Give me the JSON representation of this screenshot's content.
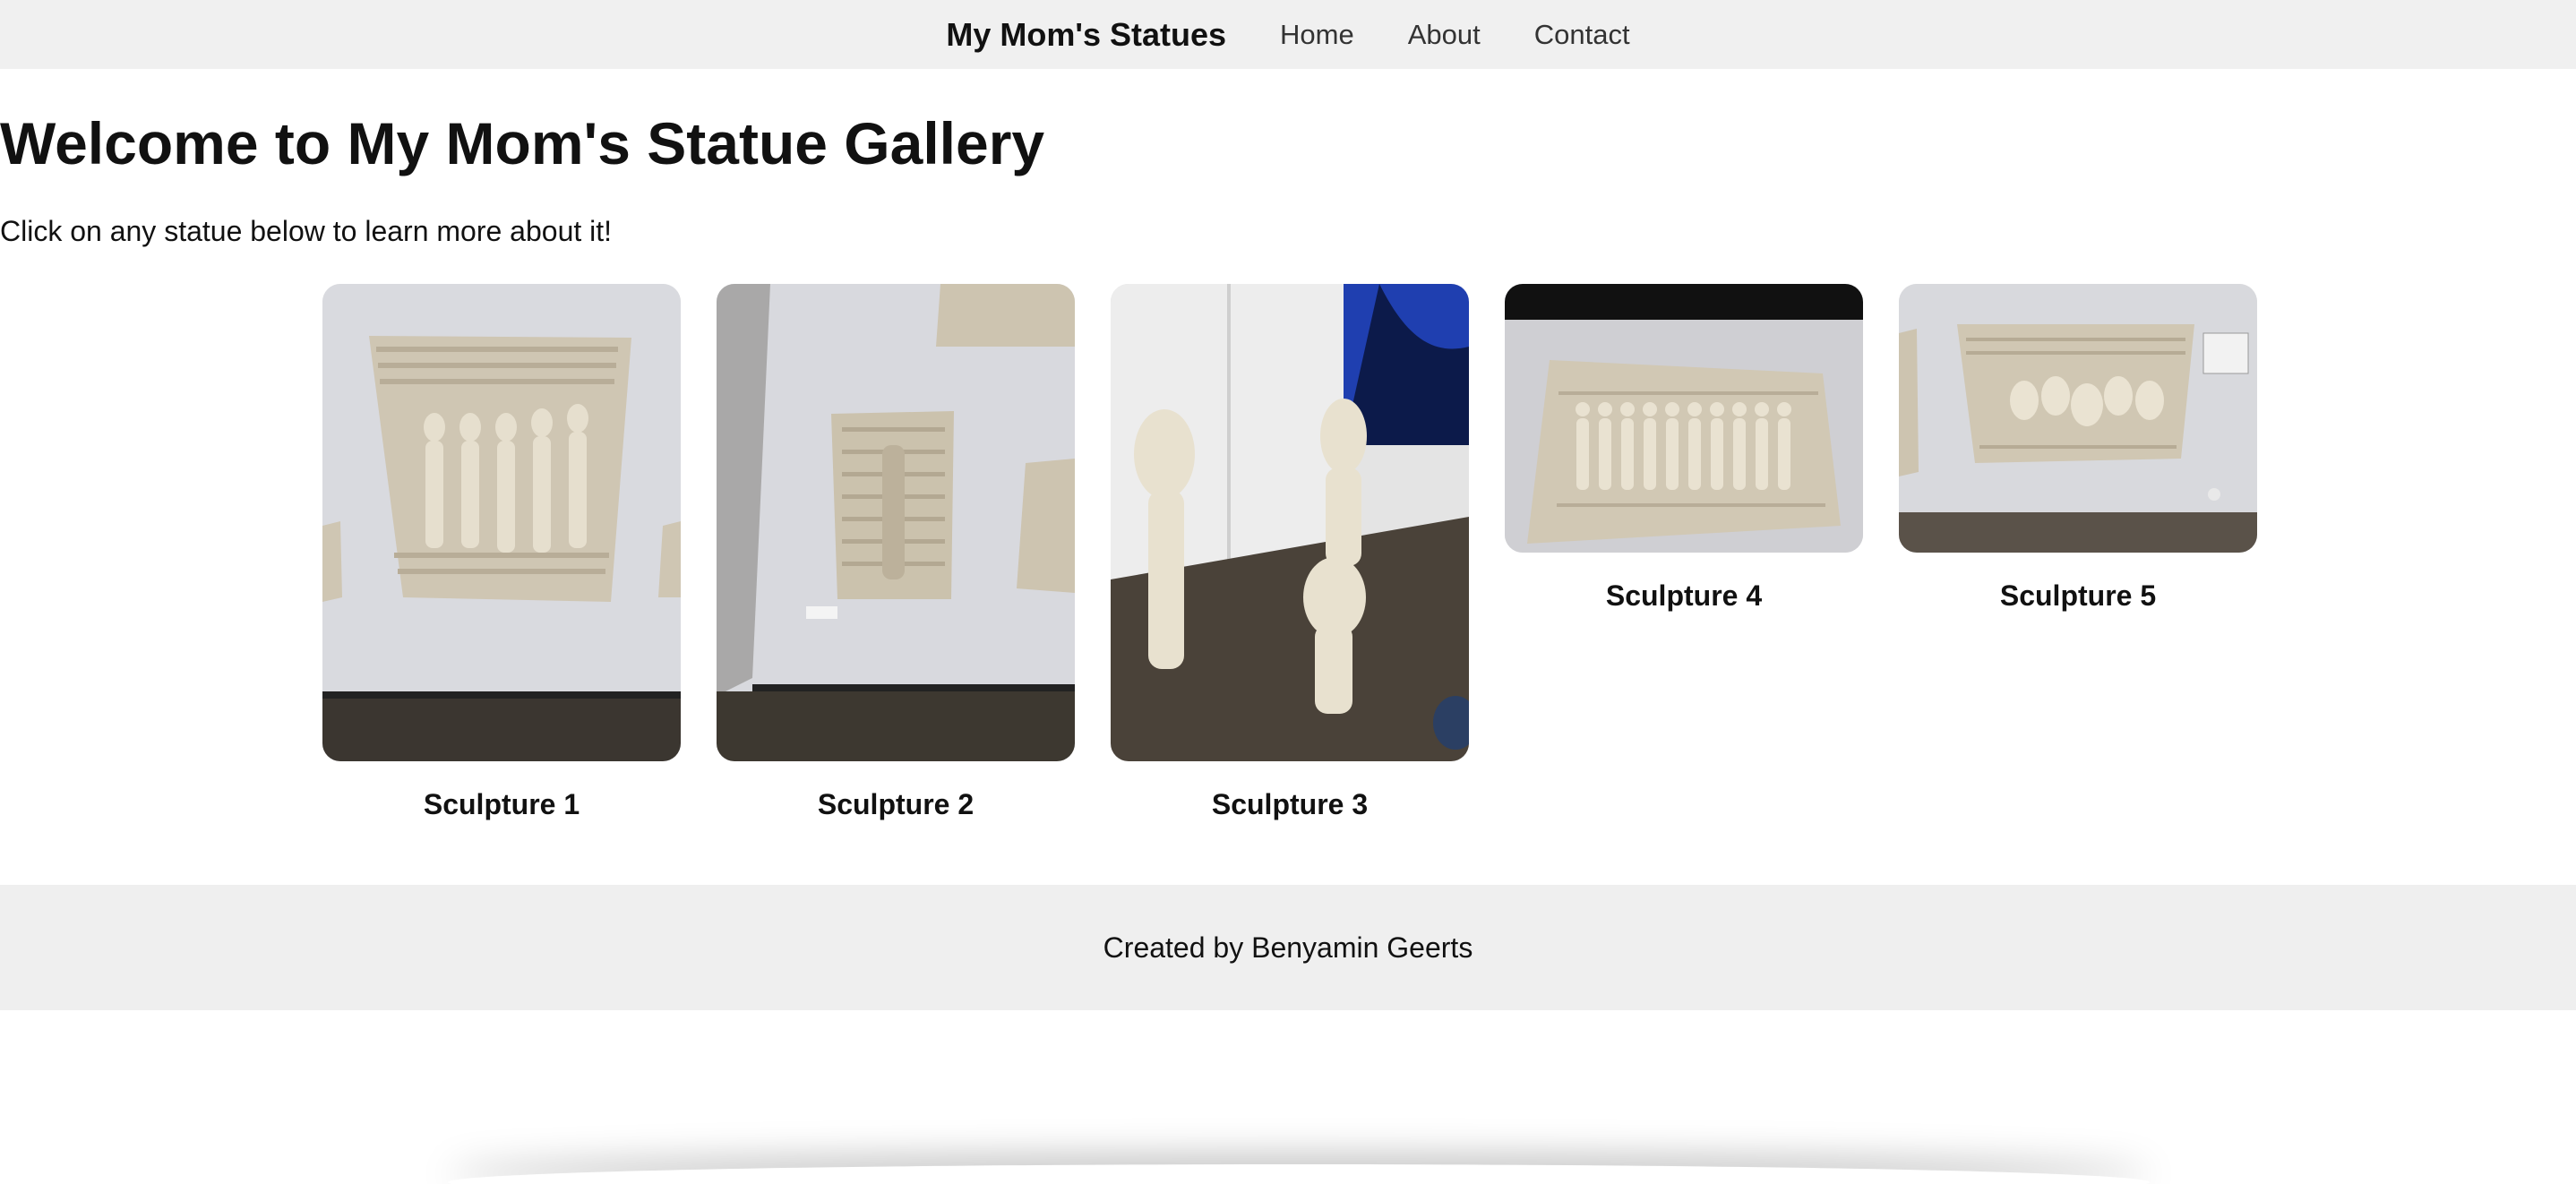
{
  "nav": {
    "brand": "My Mom's Statues",
    "links": [
      "Home",
      "About",
      "Contact"
    ]
  },
  "main": {
    "title": "Welcome to My Mom's Statue Gallery",
    "intro": "Click on any statue below to learn more about it!",
    "sculptures": [
      {
        "caption": "Sculpture 1",
        "image": "wall relief with standing figures"
      },
      {
        "caption": "Sculpture 2",
        "image": "textured wall relief panel"
      },
      {
        "caption": "Sculpture 3",
        "image": "two tall standing statues"
      },
      {
        "caption": "Sculpture 4",
        "image": "wide wall relief with many figures"
      },
      {
        "caption": "Sculpture 5",
        "image": "wall relief with faces"
      }
    ]
  },
  "footer": {
    "text": "Created by Benyamin Geerts"
  },
  "colors": {
    "nav_bg": "#f0f0f0",
    "footer_bg": "#efefef",
    "text": "#111111"
  }
}
